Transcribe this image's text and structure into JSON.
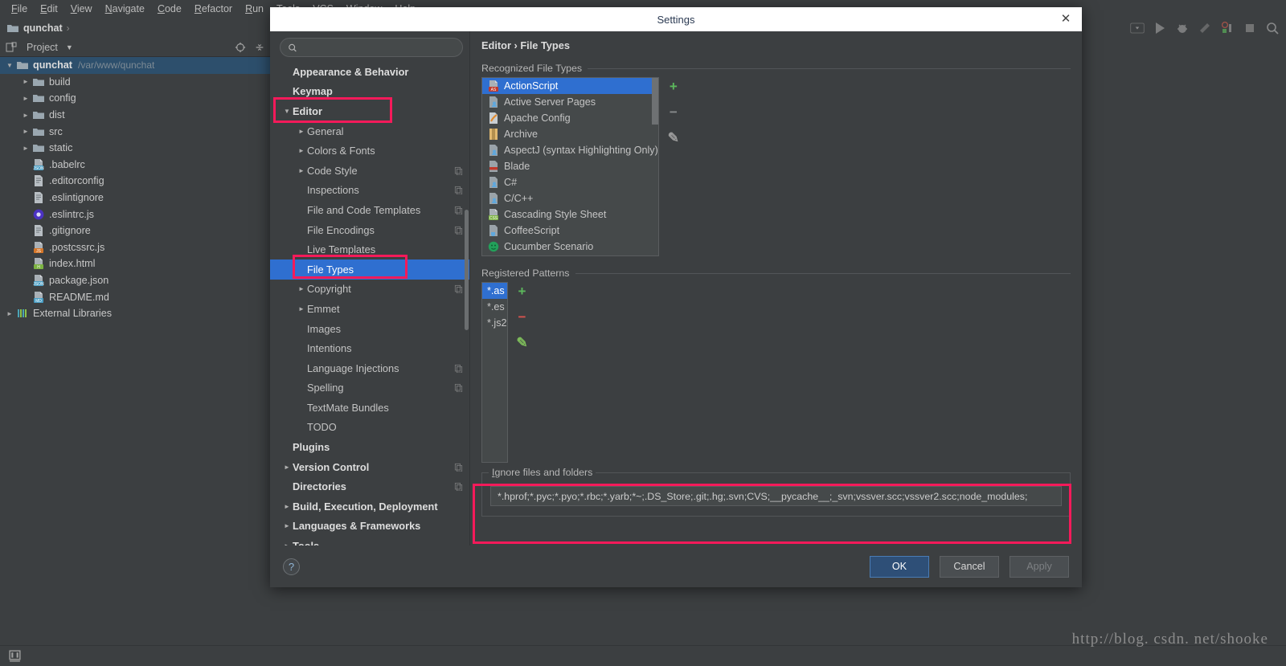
{
  "ide": {
    "menu": [
      "File",
      "Edit",
      "View",
      "Navigate",
      "Code",
      "Refactor",
      "Run",
      "Tools",
      "VCS",
      "Window",
      "Help"
    ],
    "breadcrumb": "qunchat",
    "breadcrumb_sep": "›",
    "project_panel_title": "Project",
    "watermark": "http://blog. csdn. net/shooke",
    "tree": [
      {
        "label": "qunchat",
        "note": "/var/www/qunchat",
        "icon": "folder-icon",
        "expanded": true,
        "depth": 0,
        "bold": true,
        "selected": true
      },
      {
        "label": "build",
        "note": "",
        "icon": "folder-icon",
        "expanded": false,
        "depth": 1,
        "bold": false,
        "selected": false
      },
      {
        "label": "config",
        "note": "",
        "icon": "folder-icon",
        "expanded": false,
        "depth": 1,
        "bold": false,
        "selected": false
      },
      {
        "label": "dist",
        "note": "",
        "icon": "folder-icon",
        "expanded": false,
        "depth": 1,
        "bold": false,
        "selected": false
      },
      {
        "label": "src",
        "note": "",
        "icon": "folder-icon",
        "expanded": false,
        "depth": 1,
        "bold": false,
        "selected": false
      },
      {
        "label": "static",
        "note": "",
        "icon": "folder-icon",
        "expanded": false,
        "depth": 1,
        "bold": false,
        "selected": false
      },
      {
        "label": ".babelrc",
        "note": "",
        "icon": "json-file-icon",
        "expanded": null,
        "depth": 1,
        "bold": false,
        "selected": false
      },
      {
        "label": ".editorconfig",
        "note": "",
        "icon": "text-file-icon",
        "expanded": null,
        "depth": 1,
        "bold": false,
        "selected": false
      },
      {
        "label": ".eslintignore",
        "note": "",
        "icon": "text-file-icon",
        "expanded": null,
        "depth": 1,
        "bold": false,
        "selected": false
      },
      {
        "label": ".eslintrc.js",
        "note": "",
        "icon": "eslint-file-icon",
        "expanded": null,
        "depth": 1,
        "bold": false,
        "selected": false
      },
      {
        "label": ".gitignore",
        "note": "",
        "icon": "text-file-icon",
        "expanded": null,
        "depth": 1,
        "bold": false,
        "selected": false
      },
      {
        "label": ".postcssrc.js",
        "note": "",
        "icon": "js-file-icon",
        "expanded": null,
        "depth": 1,
        "bold": false,
        "selected": false
      },
      {
        "label": "index.html",
        "note": "",
        "icon": "html-file-icon",
        "expanded": null,
        "depth": 1,
        "bold": false,
        "selected": false
      },
      {
        "label": "package.json",
        "note": "",
        "icon": "json-file-icon",
        "expanded": null,
        "depth": 1,
        "bold": false,
        "selected": false
      },
      {
        "label": "README.md",
        "note": "",
        "icon": "md-file-icon",
        "expanded": null,
        "depth": 1,
        "bold": false,
        "selected": false
      },
      {
        "label": "External Libraries",
        "note": "",
        "icon": "libraries-icon",
        "expanded": false,
        "depth": 0,
        "bold": false,
        "selected": false
      }
    ]
  },
  "dialog": {
    "title": "Settings",
    "close_label": "✕",
    "search": {
      "value": "",
      "placeholder": ""
    },
    "nav": [
      {
        "label": "Appearance & Behavior",
        "depth": 0,
        "bold": true,
        "arrow": "none",
        "copy": false,
        "selected": false
      },
      {
        "label": "Keymap",
        "depth": 0,
        "bold": true,
        "arrow": "none",
        "copy": false,
        "selected": false
      },
      {
        "label": "Editor",
        "depth": 0,
        "bold": true,
        "arrow": "down",
        "copy": false,
        "selected": false
      },
      {
        "label": "General",
        "depth": 1,
        "bold": false,
        "arrow": "right",
        "copy": false,
        "selected": false
      },
      {
        "label": "Colors & Fonts",
        "depth": 1,
        "bold": false,
        "arrow": "right",
        "copy": false,
        "selected": false
      },
      {
        "label": "Code Style",
        "depth": 1,
        "bold": false,
        "arrow": "right",
        "copy": true,
        "selected": false
      },
      {
        "label": "Inspections",
        "depth": 1,
        "bold": false,
        "arrow": "none",
        "copy": true,
        "selected": false
      },
      {
        "label": "File and Code Templates",
        "depth": 1,
        "bold": false,
        "arrow": "none",
        "copy": true,
        "selected": false
      },
      {
        "label": "File Encodings",
        "depth": 1,
        "bold": false,
        "arrow": "none",
        "copy": true,
        "selected": false
      },
      {
        "label": "Live Templates",
        "depth": 1,
        "bold": false,
        "arrow": "none",
        "copy": false,
        "selected": false
      },
      {
        "label": "File Types",
        "depth": 1,
        "bold": false,
        "arrow": "none",
        "copy": false,
        "selected": true
      },
      {
        "label": "Copyright",
        "depth": 1,
        "bold": false,
        "arrow": "right",
        "copy": true,
        "selected": false
      },
      {
        "label": "Emmet",
        "depth": 1,
        "bold": false,
        "arrow": "right",
        "copy": false,
        "selected": false
      },
      {
        "label": "Images",
        "depth": 1,
        "bold": false,
        "arrow": "none",
        "copy": false,
        "selected": false
      },
      {
        "label": "Intentions",
        "depth": 1,
        "bold": false,
        "arrow": "none",
        "copy": false,
        "selected": false
      },
      {
        "label": "Language Injections",
        "depth": 1,
        "bold": false,
        "arrow": "none",
        "copy": true,
        "selected": false
      },
      {
        "label": "Spelling",
        "depth": 1,
        "bold": false,
        "arrow": "none",
        "copy": true,
        "selected": false
      },
      {
        "label": "TextMate Bundles",
        "depth": 1,
        "bold": false,
        "arrow": "none",
        "copy": false,
        "selected": false
      },
      {
        "label": "TODO",
        "depth": 1,
        "bold": false,
        "arrow": "none",
        "copy": false,
        "selected": false
      },
      {
        "label": "Plugins",
        "depth": 0,
        "bold": true,
        "arrow": "none",
        "copy": false,
        "selected": false
      },
      {
        "label": "Version Control",
        "depth": 0,
        "bold": true,
        "arrow": "right",
        "copy": true,
        "selected": false
      },
      {
        "label": "Directories",
        "depth": 0,
        "bold": true,
        "arrow": "none",
        "copy": true,
        "selected": false
      },
      {
        "label": "Build, Execution, Deployment",
        "depth": 0,
        "bold": true,
        "arrow": "right",
        "copy": false,
        "selected": false
      },
      {
        "label": "Languages & Frameworks",
        "depth": 0,
        "bold": true,
        "arrow": "right",
        "copy": false,
        "selected": false
      },
      {
        "label": "Tools",
        "depth": 0,
        "bold": true,
        "arrow": "right",
        "copy": false,
        "selected": false
      }
    ],
    "breadcrumb": "Editor › File Types",
    "recognized": {
      "label": "Recognized File Types",
      "items": [
        {
          "label": "ActionScript",
          "icon": "as-file-icon",
          "selected": true
        },
        {
          "label": "Active Server Pages",
          "icon": "generic-lang-file-icon",
          "selected": false
        },
        {
          "label": "Apache Config",
          "icon": "apache-file-icon",
          "selected": false
        },
        {
          "label": "Archive",
          "icon": "archive-icon",
          "selected": false
        },
        {
          "label": "AspectJ (syntax Highlighting Only)",
          "icon": "generic-lang-file-icon",
          "selected": false
        },
        {
          "label": "Blade",
          "icon": "blade-file-icon",
          "selected": false
        },
        {
          "label": "C#",
          "icon": "generic-lang-file-icon",
          "selected": false
        },
        {
          "label": "C/C++",
          "icon": "generic-lang-file-icon",
          "selected": false
        },
        {
          "label": "Cascading Style Sheet",
          "icon": "css-file-icon",
          "selected": false
        },
        {
          "label": "CoffeeScript",
          "icon": "coffee-file-icon",
          "selected": false
        },
        {
          "label": "Cucumber Scenario",
          "icon": "cucumber-icon",
          "selected": false
        }
      ],
      "buttons": [
        {
          "name": "add-file-type-button",
          "glyph": "+",
          "color": "#5cb85c",
          "enabled": true
        },
        {
          "name": "remove-file-type-button",
          "glyph": "−",
          "color": "#888b8d",
          "enabled": false
        },
        {
          "name": "edit-file-type-button",
          "glyph": "✎",
          "color": "#9a9a9a",
          "enabled": true
        }
      ]
    },
    "registered": {
      "label": "Registered Patterns",
      "items": [
        {
          "label": "*.as",
          "selected": true
        },
        {
          "label": "*.es",
          "selected": false
        },
        {
          "label": "*.js2",
          "selected": false
        }
      ],
      "buttons": [
        {
          "name": "add-pattern-button",
          "glyph": "+",
          "color": "#5cb85c",
          "enabled": true
        },
        {
          "name": "remove-pattern-button",
          "glyph": "−",
          "color": "#d9534f",
          "enabled": true
        },
        {
          "name": "edit-pattern-button",
          "glyph": "✎",
          "color": "#7dbb5a",
          "enabled": true
        }
      ]
    },
    "ignore": {
      "label": "Ignore files and folders",
      "value": "*.hprof;*.pyc;*.pyo;*.rbc;*.yarb;*~;.DS_Store;.git;.hg;.svn;CVS;__pycache__;_svn;vssver.scc;vssver2.scc;node_modules;",
      "placeholder": ""
    },
    "footer": {
      "help_glyph": "?",
      "ok_label": "OK",
      "cancel_label": "Cancel",
      "apply_label": "Apply"
    }
  },
  "colors": {
    "selection_blue": "#2f6fd0",
    "annotation_red": "#f51a5a",
    "window_bg": "#3c3f41",
    "field_bg": "#45494a"
  }
}
